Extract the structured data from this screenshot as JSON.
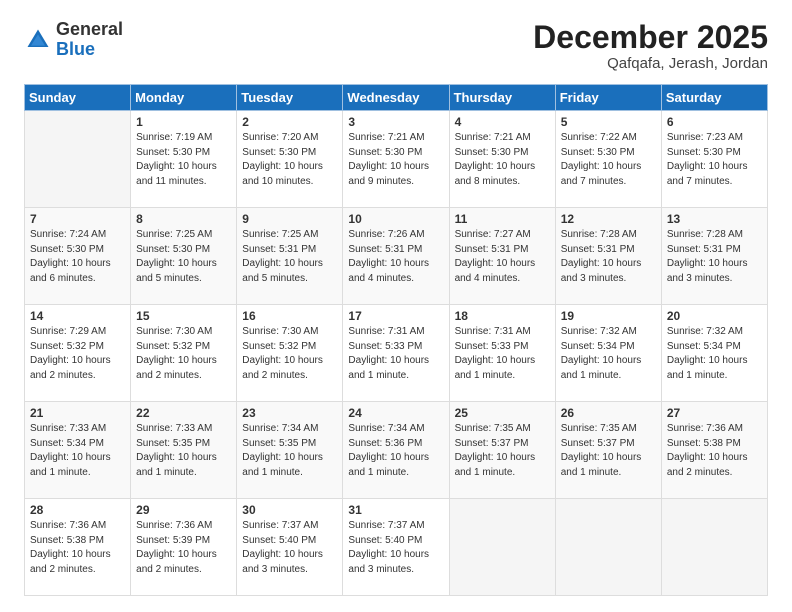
{
  "logo": {
    "general": "General",
    "blue": "Blue"
  },
  "header": {
    "month": "December 2025",
    "location": "Qafqafa, Jerash, Jordan"
  },
  "weekdays": [
    "Sunday",
    "Monday",
    "Tuesday",
    "Wednesday",
    "Thursday",
    "Friday",
    "Saturday"
  ],
  "weeks": [
    [
      {
        "num": "",
        "info": ""
      },
      {
        "num": "1",
        "info": "Sunrise: 7:19 AM\nSunset: 5:30 PM\nDaylight: 10 hours\nand 11 minutes."
      },
      {
        "num": "2",
        "info": "Sunrise: 7:20 AM\nSunset: 5:30 PM\nDaylight: 10 hours\nand 10 minutes."
      },
      {
        "num": "3",
        "info": "Sunrise: 7:21 AM\nSunset: 5:30 PM\nDaylight: 10 hours\nand 9 minutes."
      },
      {
        "num": "4",
        "info": "Sunrise: 7:21 AM\nSunset: 5:30 PM\nDaylight: 10 hours\nand 8 minutes."
      },
      {
        "num": "5",
        "info": "Sunrise: 7:22 AM\nSunset: 5:30 PM\nDaylight: 10 hours\nand 7 minutes."
      },
      {
        "num": "6",
        "info": "Sunrise: 7:23 AM\nSunset: 5:30 PM\nDaylight: 10 hours\nand 7 minutes."
      }
    ],
    [
      {
        "num": "7",
        "info": "Sunrise: 7:24 AM\nSunset: 5:30 PM\nDaylight: 10 hours\nand 6 minutes."
      },
      {
        "num": "8",
        "info": "Sunrise: 7:25 AM\nSunset: 5:30 PM\nDaylight: 10 hours\nand 5 minutes."
      },
      {
        "num": "9",
        "info": "Sunrise: 7:25 AM\nSunset: 5:31 PM\nDaylight: 10 hours\nand 5 minutes."
      },
      {
        "num": "10",
        "info": "Sunrise: 7:26 AM\nSunset: 5:31 PM\nDaylight: 10 hours\nand 4 minutes."
      },
      {
        "num": "11",
        "info": "Sunrise: 7:27 AM\nSunset: 5:31 PM\nDaylight: 10 hours\nand 4 minutes."
      },
      {
        "num": "12",
        "info": "Sunrise: 7:28 AM\nSunset: 5:31 PM\nDaylight: 10 hours\nand 3 minutes."
      },
      {
        "num": "13",
        "info": "Sunrise: 7:28 AM\nSunset: 5:31 PM\nDaylight: 10 hours\nand 3 minutes."
      }
    ],
    [
      {
        "num": "14",
        "info": "Sunrise: 7:29 AM\nSunset: 5:32 PM\nDaylight: 10 hours\nand 2 minutes."
      },
      {
        "num": "15",
        "info": "Sunrise: 7:30 AM\nSunset: 5:32 PM\nDaylight: 10 hours\nand 2 minutes."
      },
      {
        "num": "16",
        "info": "Sunrise: 7:30 AM\nSunset: 5:32 PM\nDaylight: 10 hours\nand 2 minutes."
      },
      {
        "num": "17",
        "info": "Sunrise: 7:31 AM\nSunset: 5:33 PM\nDaylight: 10 hours\nand 1 minute."
      },
      {
        "num": "18",
        "info": "Sunrise: 7:31 AM\nSunset: 5:33 PM\nDaylight: 10 hours\nand 1 minute."
      },
      {
        "num": "19",
        "info": "Sunrise: 7:32 AM\nSunset: 5:34 PM\nDaylight: 10 hours\nand 1 minute."
      },
      {
        "num": "20",
        "info": "Sunrise: 7:32 AM\nSunset: 5:34 PM\nDaylight: 10 hours\nand 1 minute."
      }
    ],
    [
      {
        "num": "21",
        "info": "Sunrise: 7:33 AM\nSunset: 5:34 PM\nDaylight: 10 hours\nand 1 minute."
      },
      {
        "num": "22",
        "info": "Sunrise: 7:33 AM\nSunset: 5:35 PM\nDaylight: 10 hours\nand 1 minute."
      },
      {
        "num": "23",
        "info": "Sunrise: 7:34 AM\nSunset: 5:35 PM\nDaylight: 10 hours\nand 1 minute."
      },
      {
        "num": "24",
        "info": "Sunrise: 7:34 AM\nSunset: 5:36 PM\nDaylight: 10 hours\nand 1 minute."
      },
      {
        "num": "25",
        "info": "Sunrise: 7:35 AM\nSunset: 5:37 PM\nDaylight: 10 hours\nand 1 minute."
      },
      {
        "num": "26",
        "info": "Sunrise: 7:35 AM\nSunset: 5:37 PM\nDaylight: 10 hours\nand 1 minute."
      },
      {
        "num": "27",
        "info": "Sunrise: 7:36 AM\nSunset: 5:38 PM\nDaylight: 10 hours\nand 2 minutes."
      }
    ],
    [
      {
        "num": "28",
        "info": "Sunrise: 7:36 AM\nSunset: 5:38 PM\nDaylight: 10 hours\nand 2 minutes."
      },
      {
        "num": "29",
        "info": "Sunrise: 7:36 AM\nSunset: 5:39 PM\nDaylight: 10 hours\nand 2 minutes."
      },
      {
        "num": "30",
        "info": "Sunrise: 7:37 AM\nSunset: 5:40 PM\nDaylight: 10 hours\nand 3 minutes."
      },
      {
        "num": "31",
        "info": "Sunrise: 7:37 AM\nSunset: 5:40 PM\nDaylight: 10 hours\nand 3 minutes."
      },
      {
        "num": "",
        "info": ""
      },
      {
        "num": "",
        "info": ""
      },
      {
        "num": "",
        "info": ""
      }
    ]
  ]
}
